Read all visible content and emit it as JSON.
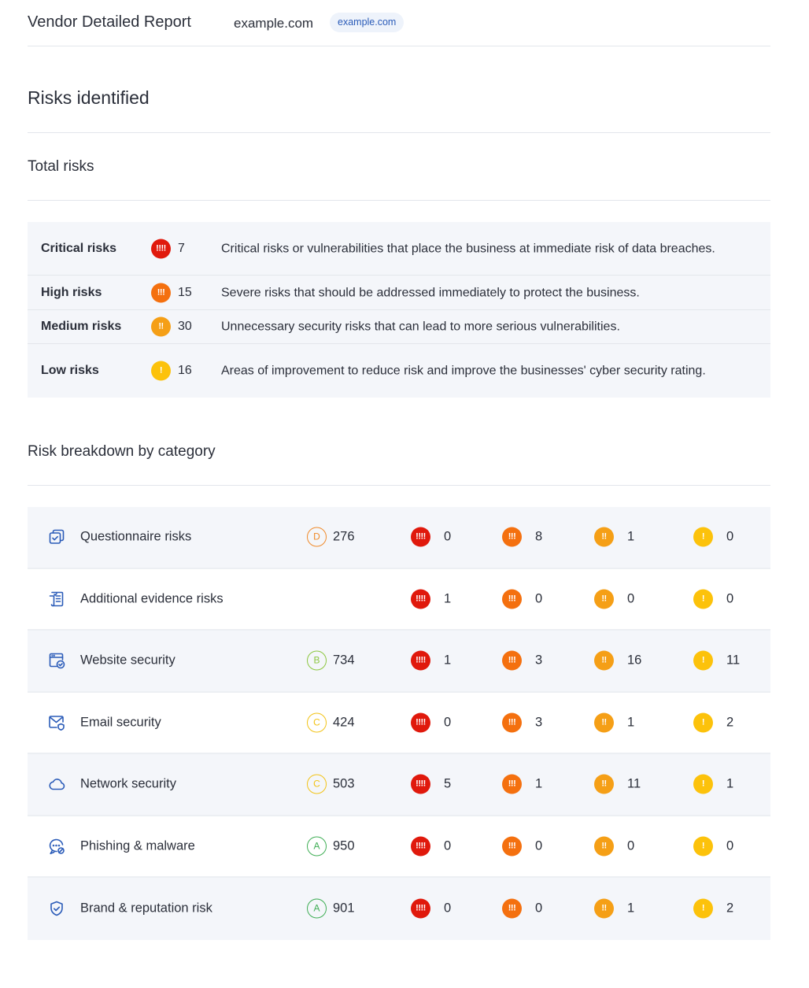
{
  "header": {
    "title": "Vendor Detailed Report",
    "domain": "example.com",
    "domain_pill": "example.com"
  },
  "risks_identified": {
    "title": "Risks identified"
  },
  "total_risks": {
    "title": "Total risks",
    "rows": [
      {
        "label": "Critical risks",
        "severity": "critical",
        "glyph": "!!!!",
        "count": "7",
        "description": "Critical risks or vulnerabilities that place the business at immediate risk of data breaches."
      },
      {
        "label": "High risks",
        "severity": "high",
        "glyph": "!!!",
        "count": "15",
        "description": "Severe risks that should be addressed immediately to protect the business."
      },
      {
        "label": "Medium risks",
        "severity": "medium",
        "glyph": "!!",
        "count": "30",
        "description": "Unnecessary security risks that can lead to more serious vulnerabilities."
      },
      {
        "label": "Low risks",
        "severity": "low",
        "glyph": "!",
        "count": "16",
        "description": "Areas of improvement to reduce risk and improve the businesses' cyber security rating."
      }
    ]
  },
  "severity_glyphs": {
    "critical": "!!!!",
    "high": "!!!",
    "medium": "!!",
    "low": "!"
  },
  "colors": {
    "critical": "#e0190c",
    "high": "#f4700f",
    "medium": "#f59f16",
    "low": "#fcc20b",
    "grade_a": "#3fae55",
    "grade_b": "#8cc63f",
    "grade_c": "#f2c316",
    "grade_d": "#f08a2a",
    "icon": "#2a5bb8",
    "accent_pill": "#eef3fb"
  },
  "breakdown": {
    "title": "Risk breakdown by category",
    "rows": [
      {
        "name": "Questionnaire risks",
        "icon": "questionnaire-icon",
        "grade": "D",
        "score": "276",
        "critical": "0",
        "high": "8",
        "medium": "1",
        "low": "0"
      },
      {
        "name": "Additional evidence risks",
        "icon": "evidence-icon",
        "grade": "",
        "score": "",
        "critical": "1",
        "high": "0",
        "medium": "0",
        "low": "0"
      },
      {
        "name": "Website security",
        "icon": "website-icon",
        "grade": "B",
        "score": "734",
        "critical": "1",
        "high": "3",
        "medium": "16",
        "low": "11"
      },
      {
        "name": "Email security",
        "icon": "email-icon",
        "grade": "C",
        "score": "424",
        "critical": "0",
        "high": "3",
        "medium": "1",
        "low": "2"
      },
      {
        "name": "Network security",
        "icon": "cloud-icon",
        "grade": "C",
        "score": "503",
        "critical": "5",
        "high": "1",
        "medium": "11",
        "low": "1"
      },
      {
        "name": "Phishing & malware",
        "icon": "phishing-icon",
        "grade": "A",
        "score": "950",
        "critical": "0",
        "high": "0",
        "medium": "0",
        "low": "0"
      },
      {
        "name": "Brand & reputation risk",
        "icon": "shield-icon",
        "grade": "A",
        "score": "901",
        "critical": "0",
        "high": "0",
        "medium": "1",
        "low": "2"
      }
    ]
  }
}
